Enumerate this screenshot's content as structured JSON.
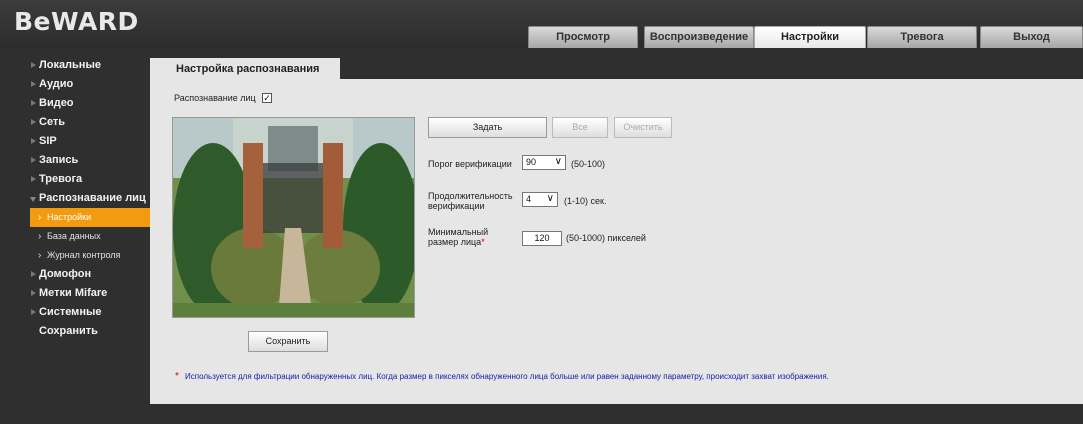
{
  "brand": {
    "logo": "BeWARD"
  },
  "tabs": [
    {
      "label": "Просмотр",
      "active": false
    },
    {
      "label": "Воспроизведение",
      "active": false
    },
    {
      "label": "Настройки",
      "active": true
    },
    {
      "label": "Тревога",
      "active": false
    },
    {
      "label": "Выход",
      "active": false
    }
  ],
  "sidebar": {
    "items": [
      {
        "label": "Локальные"
      },
      {
        "label": "Аудио"
      },
      {
        "label": "Видео"
      },
      {
        "label": "Сеть"
      },
      {
        "label": "SIP"
      },
      {
        "label": "Запись"
      },
      {
        "label": "Тревога"
      },
      {
        "label": "Распознавание лиц"
      },
      {
        "label": "Настройки"
      },
      {
        "label": "База данных"
      },
      {
        "label": "Журнал контроля"
      },
      {
        "label": "Домофон"
      },
      {
        "label": "Метки Mifare"
      },
      {
        "label": "Системные"
      },
      {
        "label": "Сохранить"
      }
    ]
  },
  "page": {
    "tab_title": "Настройка распознавания",
    "face_recognition_label": "Распознавание лиц",
    "face_recognition_checked": true,
    "check_mark": "✓"
  },
  "buttons": {
    "set": "Задать",
    "all": "Все",
    "clear": "Очистить",
    "save": "Сохранить"
  },
  "fields": {
    "threshold_label": "Порог верификации",
    "threshold_value": "90",
    "threshold_range": "(50-100)",
    "duration_label_1": "Продолжительность",
    "duration_label_2": "верификации",
    "duration_value": "4",
    "duration_range": "(1-10) сек.",
    "minsize_label_1": "Минимальный",
    "minsize_label_2": "размер лица",
    "minsize_star": "*",
    "minsize_value": "120",
    "minsize_range": "(50-1000) пикселей"
  },
  "footnote": {
    "star": "*",
    "text": "Используется для фильтрации обнаруженных лиц. Когда размер в пикселях обнаруженного лица больше или равен заданному параметру, происходит захват изображения."
  },
  "icons": {
    "dropdown": "chevron-down-icon",
    "submenu": "chevron-right-icon",
    "collapsed": "triangle-right-icon",
    "expanded": "triangle-down-icon"
  },
  "colors": {
    "accent": "#f39b0f",
    "header_bg": "#2f2f2f",
    "content_bg": "#e6e6e6",
    "footnote": "#1a1aa8"
  }
}
